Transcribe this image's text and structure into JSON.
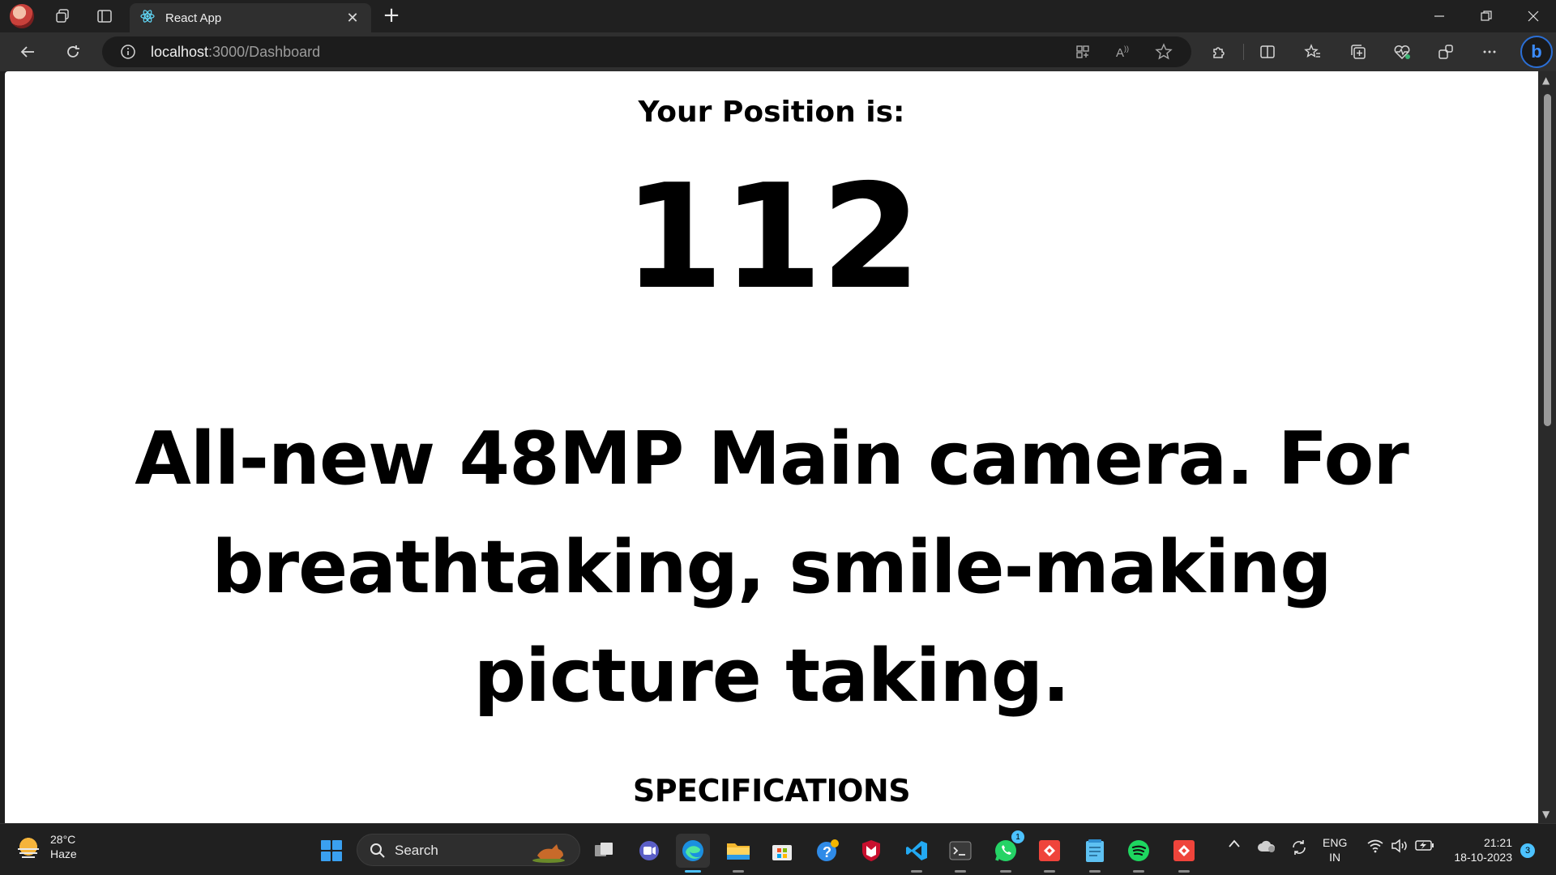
{
  "browser": {
    "tab_title": "React App",
    "url_host": "localhost",
    "url_path": ":3000/Dashboard",
    "bing_label": "b"
  },
  "page": {
    "position_label": "Your Position is:",
    "position_value": "112",
    "headline": "All-new 48MP Main camera. For breathtaking, smile-making picture taking.",
    "section_heading": "SPECIFICATIONS"
  },
  "taskbar": {
    "weather_temp": "28°C",
    "weather_desc": "Haze",
    "search_label": "Search",
    "whatsapp_badge": "1",
    "lang_primary": "ENG",
    "lang_secondary": "IN",
    "time": "21:21",
    "date": "18-10-2023",
    "notification_count": "3"
  },
  "colors": {
    "chrome_dark": "#202020",
    "toolbar": "#2f2f2f",
    "page_bg": "#ffffff",
    "text": "#000000",
    "accent": "#4cc2ff"
  }
}
